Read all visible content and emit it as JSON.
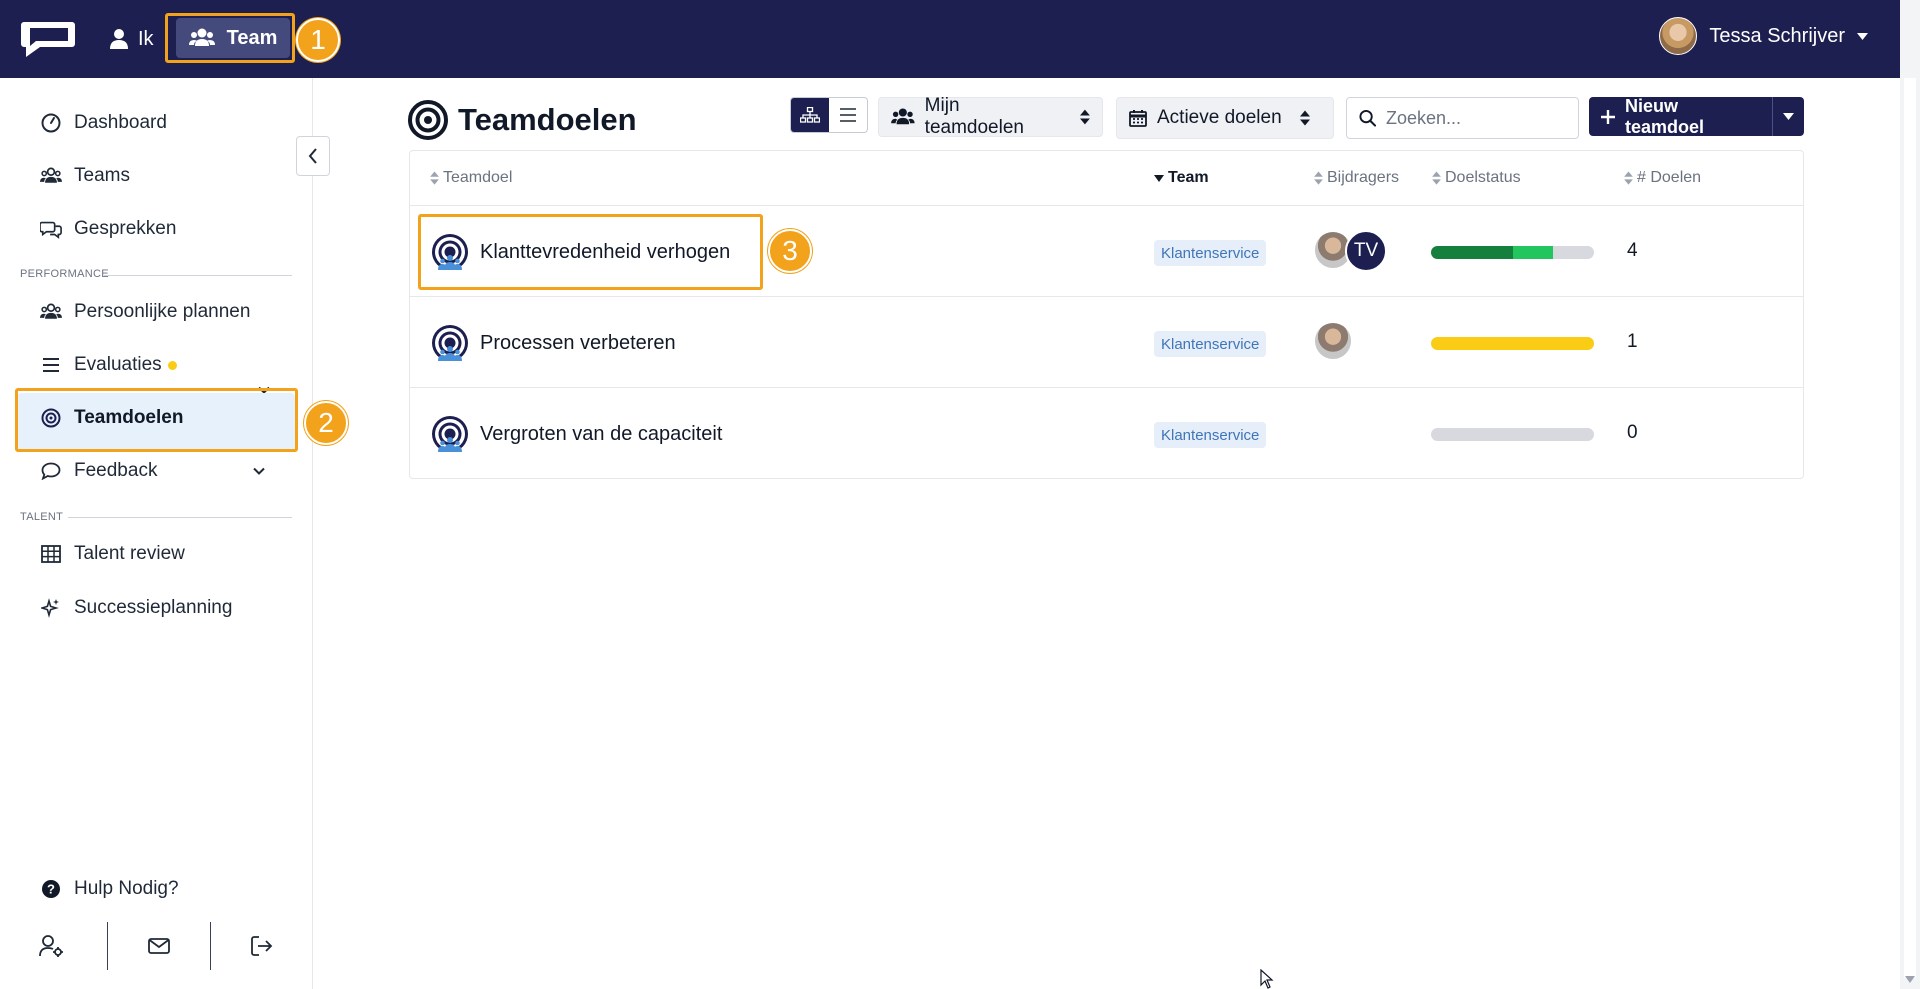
{
  "topbar": {
    "nav_ik_label": "Ik",
    "nav_team_label": "Team",
    "user_name": "Tessa Schrijver"
  },
  "annotations": {
    "badge1": "1",
    "badge2": "2",
    "badge3": "3",
    "highlight_color": "#f2a21b"
  },
  "sidebar": {
    "items": [
      {
        "label": "Dashboard",
        "icon": "gauge-icon"
      },
      {
        "label": "Teams",
        "icon": "users-icon"
      },
      {
        "label": "Gesprekken",
        "icon": "chat-bubbles-icon"
      }
    ],
    "performance_label": "PERFORMANCE",
    "performance_items": [
      {
        "label": "Persoonlijke plannen",
        "icon": "users-icon"
      },
      {
        "label": "Evaluaties",
        "icon": "list-icon"
      },
      {
        "label": "Teamdoelen",
        "icon": "target-icon"
      },
      {
        "label": "Feedback",
        "icon": "comment-icon"
      }
    ],
    "talent_label": "TALENT",
    "talent_items": [
      {
        "label": "Talent review",
        "icon": "grid-icon"
      },
      {
        "label": "Successieplanning",
        "icon": "sparkles-icon"
      }
    ],
    "help_label": "Hulp Nodig?"
  },
  "main": {
    "title": "Teamdoelen",
    "filter_scope": "Mijn teamdoelen",
    "filter_status": "Actieve doelen",
    "search_placeholder": "Zoeken...",
    "new_button": "Nieuw teamdoel",
    "columns": {
      "goal": "Teamdoel",
      "team": "Team",
      "contributors": "Bijdragers",
      "status": "Doelstatus",
      "count": "# Doelen"
    },
    "rows": [
      {
        "name": "Klanttevredenheid verhogen",
        "team": "Klantenservice",
        "initials": "TV",
        "count": "4",
        "status": [
          {
            "fraction": 0.5,
            "color": "#15803d"
          },
          {
            "fraction": 0.25,
            "color": "#22c55e"
          }
        ]
      },
      {
        "name": "Processen verbeteren",
        "team": "Klantenservice",
        "initials": "",
        "count": "1",
        "status": [
          {
            "fraction": 1.0,
            "color": "#facc15"
          }
        ]
      },
      {
        "name": "Vergroten van de capaciteit",
        "team": "Klantenservice",
        "initials": "",
        "count": "0",
        "status": []
      }
    ]
  },
  "colors": {
    "navy": "#1c1f4f",
    "active_bg": "#e7f1fb",
    "tag_text": "#3f76b8"
  }
}
